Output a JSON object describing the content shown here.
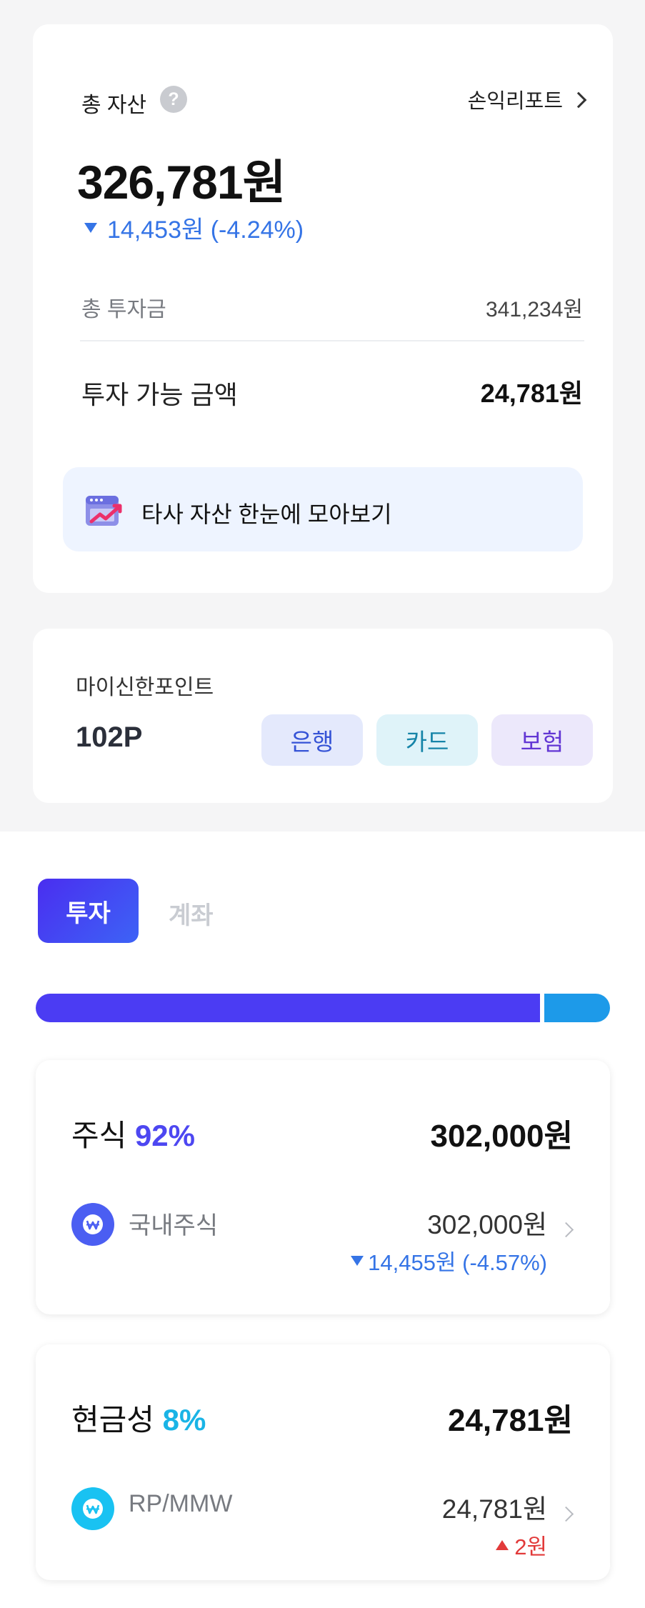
{
  "summary": {
    "total_label": "총 자산",
    "help_icon": "?",
    "report_link": "손익리포트",
    "total_amount": "326,781원",
    "total_change": "14,453원 (-4.24%)",
    "invest_label": "총 투자금",
    "invest_value": "341,234원",
    "available_label": "투자 가능 금액",
    "available_value": "24,781원",
    "banner_text": "타사 자산 한눈에 모아보기"
  },
  "points": {
    "label": "마이신한포인트",
    "value": "102P",
    "buttons": {
      "bank": "은행",
      "card": "카드",
      "insurance": "보험"
    }
  },
  "tabs": {
    "invest": "투자",
    "account": "계좌"
  },
  "allocation": {
    "stock_fraction": 0.92,
    "cash_fraction": 0.08,
    "stock_color": "#4b3cf3",
    "cash_color": "#1d9ae9"
  },
  "stock": {
    "label": "주식",
    "pct": "92%",
    "amount": "302,000원",
    "pct_color": "#4d47f1",
    "item": {
      "name": "국내주식",
      "amount": "302,000원",
      "change": "14,455원  (-4.57%)",
      "icon_color": "#4b5ef2"
    }
  },
  "cash": {
    "label": "현금성",
    "pct": "8%",
    "amount": "24,781원",
    "pct_color": "#1ab4e6",
    "item": {
      "name": "RP/MMW",
      "amount": "24,781원",
      "change": "2원",
      "icon_color": "#19c2f2"
    }
  },
  "colors": {
    "change_down": "#3574e6",
    "change_up": "#e23a3a"
  }
}
